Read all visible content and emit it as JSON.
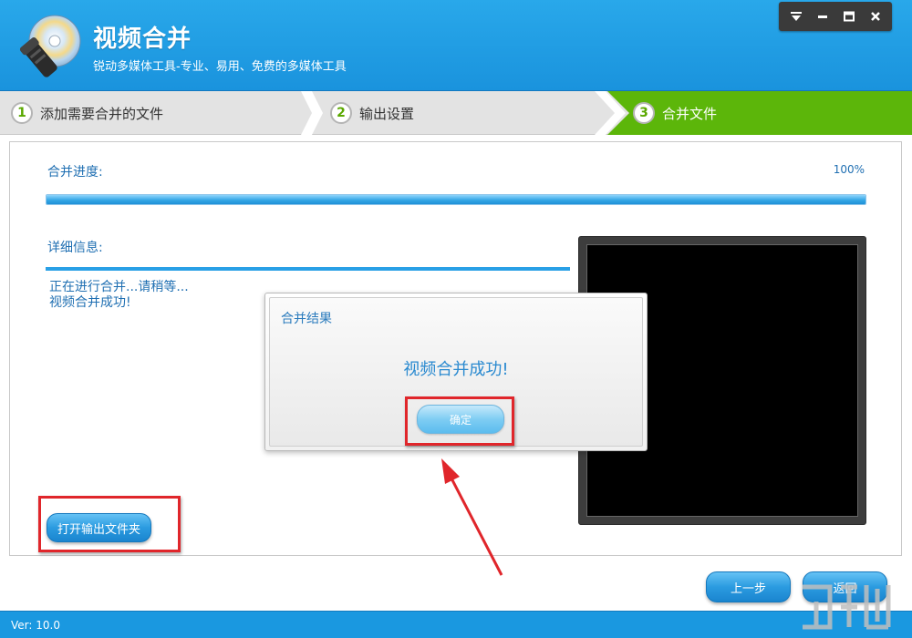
{
  "header": {
    "title": "视频合并",
    "subtitle": "锐动多媒体工具-专业、易用、免费的多媒体工具",
    "controls": [
      "menu-icon",
      "minimize-icon",
      "maximize-icon",
      "close-icon"
    ]
  },
  "steps": [
    {
      "num": "1",
      "label": "添加需要合并的文件",
      "active": false
    },
    {
      "num": "2",
      "label": "输出设置",
      "active": false
    },
    {
      "num": "3",
      "label": "合并文件",
      "active": true
    }
  ],
  "progress": {
    "label": "合并进度:",
    "percent_text": "100%",
    "value": 1.0
  },
  "details": {
    "label": "详细信息:",
    "log": [
      "正在进行合并...请稍等...",
      "视频合并成功!"
    ]
  },
  "buttons": {
    "open_folder": "打开输出文件夹",
    "prev": "上一步",
    "back": "返回"
  },
  "dialog": {
    "title": "合并结果",
    "message": "视频合并成功!",
    "ok": "确定"
  },
  "footer": {
    "version": "Ver: 10.0"
  },
  "colors": {
    "header_blue": "#1a93dd",
    "active_step_green": "#5cb60a",
    "annotation_red": "#e0262b",
    "text_blue": "#1f6fb2"
  }
}
